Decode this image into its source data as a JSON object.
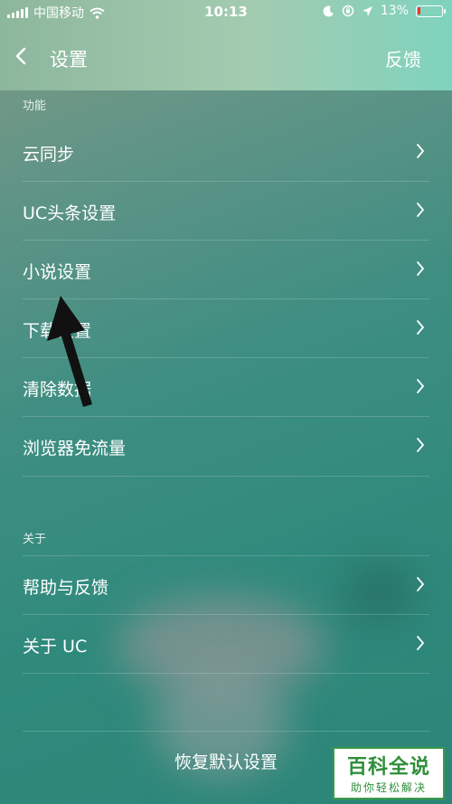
{
  "status_bar": {
    "carrier": "中国移动",
    "time": "10:13",
    "battery_percent": "13%",
    "battery_level": 0.13,
    "icons": [
      "signal-icon",
      "wifi-icon",
      "moon-icon",
      "rotation-lock-icon",
      "location-icon",
      "battery-icon"
    ]
  },
  "nav": {
    "back_icon": "chevron-left-icon",
    "title": "设置",
    "feedback_label": "反馈"
  },
  "sections": {
    "functions": {
      "label": "功能",
      "items": [
        "云同步",
        "UC头条设置",
        "小说设置",
        "下载设置",
        "清除数据",
        "浏览器免流量"
      ]
    },
    "about": {
      "label": "关于",
      "items": [
        "帮助与反馈",
        "关于 UC"
      ]
    }
  },
  "restore_label": "恢复默认设置",
  "watermark": {
    "title": "百科全说",
    "subtitle": "助你轻松解决"
  },
  "colors": {
    "header": "#a3cbb0",
    "background": "#2f8a7c",
    "battery_low": "#e53935",
    "watermark_green": "#2f8f3a"
  }
}
